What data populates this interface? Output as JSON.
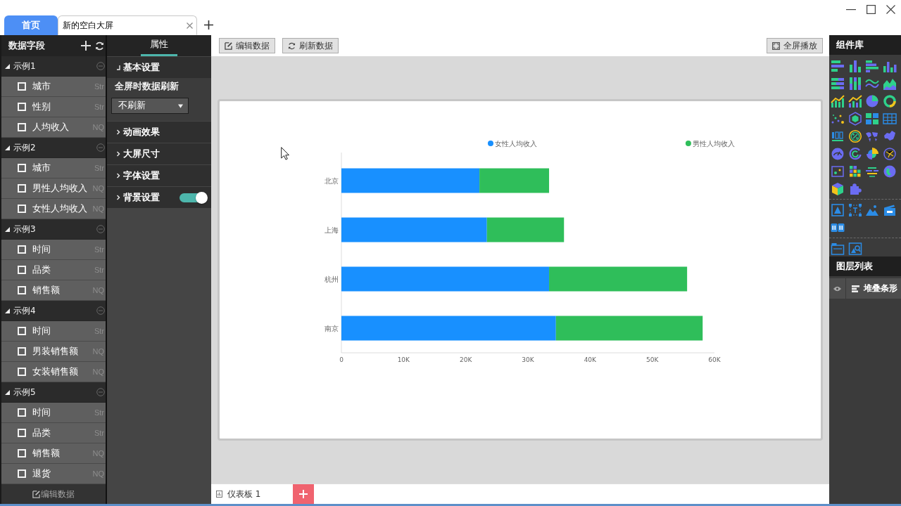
{
  "tabs": [
    {
      "label": "首页",
      "kind": "home",
      "selected": false
    },
    {
      "label": "新的空白大屏",
      "kind": "document",
      "selected": true
    }
  ],
  "data_fields": {
    "title": "数据字段",
    "groups": [
      {
        "name": "示例1",
        "expanded": true,
        "fields": [
          {
            "name": "城市",
            "type": "Str",
            "checked": false
          },
          {
            "name": "性别",
            "type": "Str",
            "checked": false
          },
          {
            "name": "人均收入",
            "type": "NQ",
            "checked": false
          }
        ]
      },
      {
        "name": "示例2",
        "expanded": true,
        "fields": [
          {
            "name": "城市",
            "type": "Str",
            "checked": false
          },
          {
            "name": "男性人均收入",
            "type": "NQ",
            "checked": false
          },
          {
            "name": "女性人均收入",
            "type": "NQ",
            "checked": false
          }
        ]
      },
      {
        "name": "示例3",
        "expanded": true,
        "fields": [
          {
            "name": "时间",
            "type": "Str",
            "checked": false
          },
          {
            "name": "品类",
            "type": "Str",
            "checked": false
          },
          {
            "name": "销售额",
            "type": "NQ",
            "checked": false
          }
        ]
      },
      {
        "name": "示例4",
        "expanded": true,
        "fields": [
          {
            "name": "时间",
            "type": "Str",
            "checked": false
          },
          {
            "name": "男装销售额",
            "type": "NQ",
            "checked": false
          },
          {
            "name": "女装销售额",
            "type": "NQ",
            "checked": false
          }
        ]
      },
      {
        "name": "示例5",
        "expanded": true,
        "fields": [
          {
            "name": "时间",
            "type": "Str",
            "checked": false
          },
          {
            "name": "品类",
            "type": "Str",
            "checked": false
          },
          {
            "name": "销售额",
            "type": "NQ",
            "checked": false
          },
          {
            "name": "退货",
            "type": "NQ",
            "checked": false
          }
        ]
      }
    ],
    "footer": "编辑数据"
  },
  "properties": {
    "tabs": [
      {
        "label": "属性",
        "selected": true
      }
    ],
    "sections": [
      {
        "title": "基本设置",
        "expanded": true,
        "fields": [
          {
            "label": "全屏时数据刷新",
            "value": "不刷新"
          }
        ]
      },
      {
        "title": "动画效果",
        "expanded": false
      },
      {
        "title": "大屏尺寸",
        "expanded": false
      },
      {
        "title": "字体设置",
        "expanded": false
      },
      {
        "title": "背景设置",
        "expanded": false,
        "toggle": {
          "on": true
        }
      }
    ]
  },
  "toolbar": {
    "left_buttons": [
      "编辑数据",
      "刷新数据"
    ],
    "right_buttons": [
      "全屏播放"
    ]
  },
  "canvas": {
    "chart": {
      "chart_data": {
        "type": "bar",
        "orientation": "horizontal",
        "stacked": true,
        "legend": "top",
        "categories": [
          "北京",
          "上海",
          "杭州",
          "南京"
        ],
        "series": [
          {
            "name": "女性人均收入",
            "color": "#1890ff",
            "values": [
              22200,
              23400,
              33400,
              34500
            ]
          },
          {
            "name": "男性人均收入",
            "color": "#2fbe5a",
            "values": [
              11200,
              12400,
              22200,
              23600
            ]
          }
        ],
        "xlim": [
          0,
          60000
        ],
        "xticks": [
          {
            "value": 0,
            "label": "0"
          },
          {
            "value": 10000,
            "label": "10K"
          },
          {
            "value": 20000,
            "label": "20K"
          },
          {
            "value": 30000,
            "label": "30K"
          },
          {
            "value": 40000,
            "label": "40K"
          },
          {
            "value": 50000,
            "label": "50K"
          },
          {
            "value": 60000,
            "label": "60K"
          }
        ]
      }
    }
  },
  "sheets": [
    {
      "label": "仪表板 1",
      "selected": true
    }
  ],
  "component_library": {
    "title": "组件库"
  },
  "layers": {
    "title": "图层列表",
    "items": [
      {
        "label": "堆叠条形",
        "visible": true,
        "selected": true
      }
    ]
  }
}
